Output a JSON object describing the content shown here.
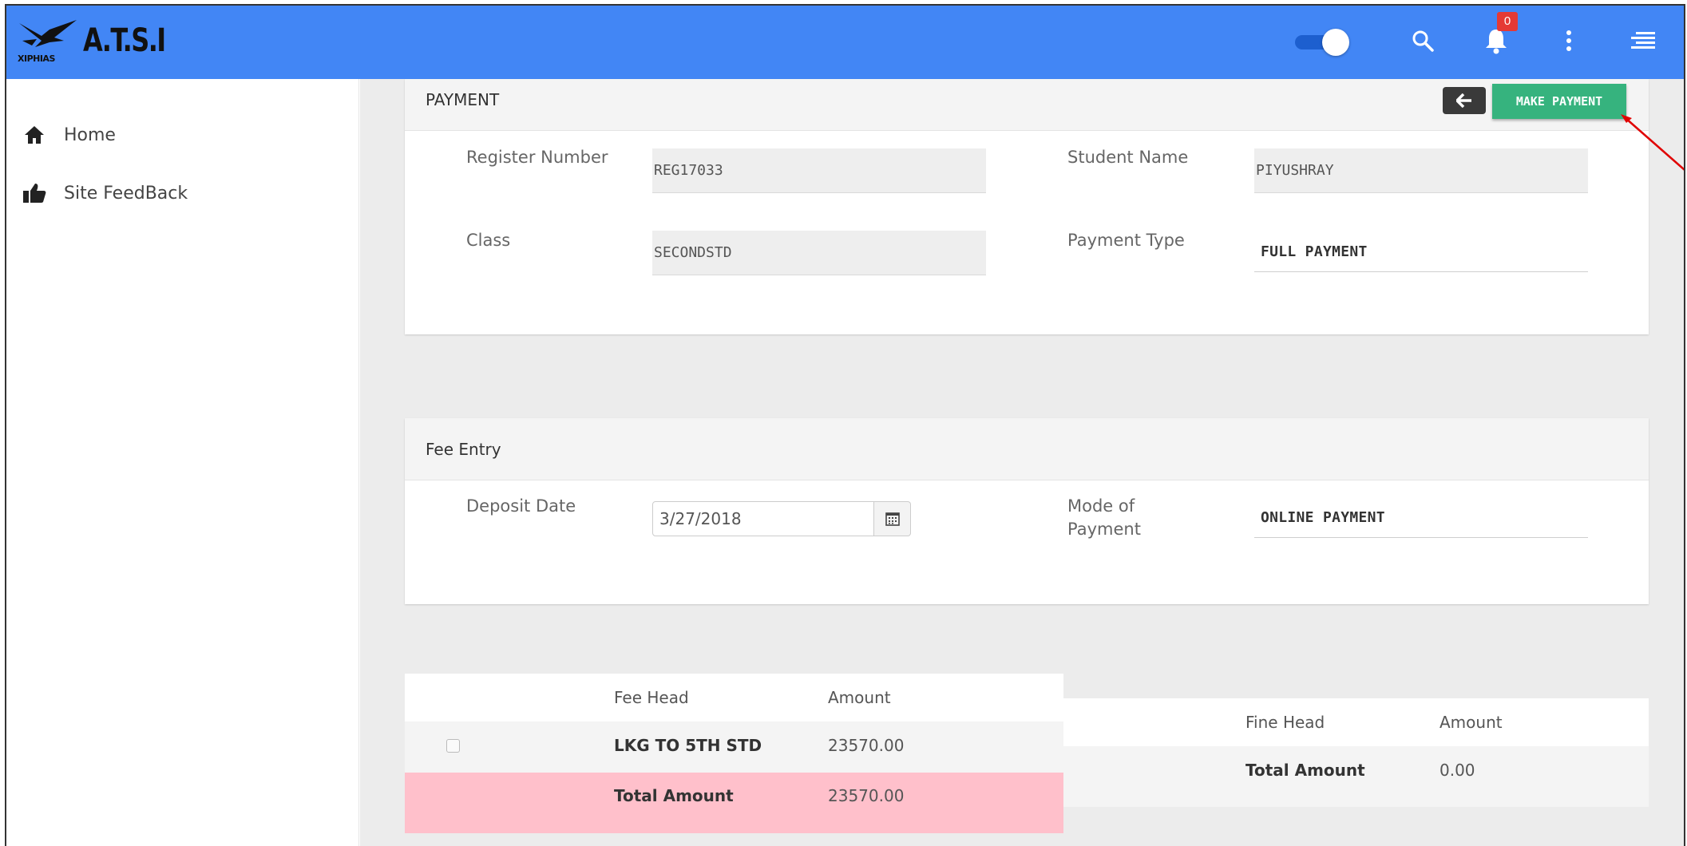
{
  "app": {
    "logo_text": "A.T.S.I",
    "logo_sub": "XIPHIAS"
  },
  "topbar": {
    "notification_count": "0",
    "accent_color": "#4286f5"
  },
  "sidebar": {
    "items": [
      {
        "label": "Home",
        "icon": "home-icon"
      },
      {
        "label": "Site FeedBack",
        "icon": "thumbs-up-icon"
      }
    ]
  },
  "payment": {
    "title": "PAYMENT",
    "make_payment_label": "MAKE PAYMENT",
    "register_number_label": "Register Number",
    "register_number_value": "REG17033",
    "student_name_label": "Student Name",
    "student_name_value": "PIYUSHRAY",
    "class_label": "Class",
    "class_value": "SECONDSTD",
    "payment_type_label": "Payment Type",
    "payment_type_value": "FULL PAYMENT"
  },
  "fee_entry": {
    "title": "Fee Entry",
    "deposit_date_label": "Deposit Date",
    "deposit_date_value": "3/27/2018",
    "mode_label_line1": "Mode of",
    "mode_label_line2": "Payment",
    "mode_value": "ONLINE PAYMENT"
  },
  "fee_table": {
    "headers": [
      "Fee Head",
      "Amount"
    ],
    "rows": [
      {
        "fee_head": "LKG TO 5TH STD",
        "amount": "23570.00"
      }
    ],
    "total_label": "Total Amount",
    "total_value": "23570.00"
  },
  "fine_table": {
    "headers": [
      "Fine Head",
      "Amount"
    ],
    "total_label": "Total Amount",
    "total_value": "0.00"
  },
  "colors": {
    "make_payment": "#36b37e",
    "total_row": "#ffc0cb",
    "annotation_arrow": "#e00000"
  }
}
